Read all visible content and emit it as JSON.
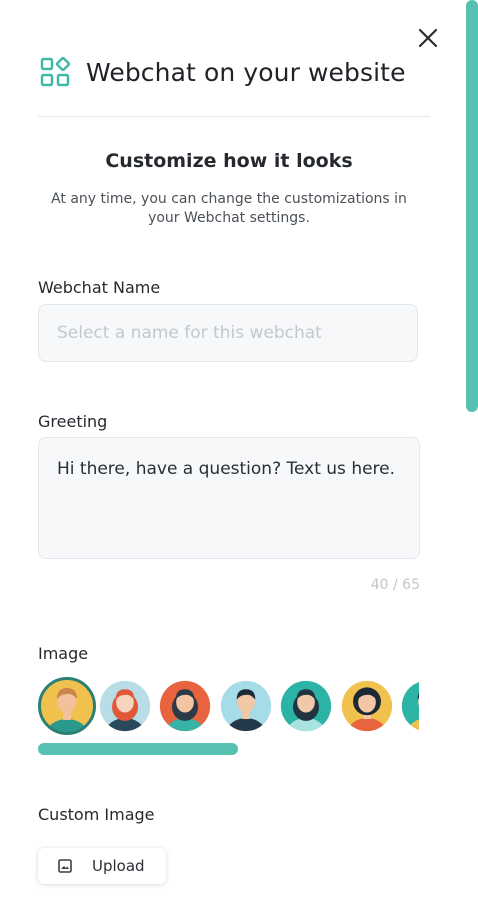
{
  "header": {
    "title": "Webchat on your website",
    "logo_icon": "widgets-icon",
    "close_icon": "close-icon"
  },
  "section": {
    "title": "Customize how it looks",
    "description": "At any time, you can change the customizations in your Webchat settings."
  },
  "webchat_name": {
    "label": "Webchat Name",
    "value": "",
    "placeholder": "Select a name for this webchat"
  },
  "greeting": {
    "label": "Greeting",
    "value": "Hi there, have a question? Text us here.",
    "counter": "40 / 65"
  },
  "image": {
    "label": "Image",
    "selected_index": 0,
    "avatars": [
      {
        "name": "avatar-man-short-hair",
        "bg": "#f1c14e",
        "skin": "#f2c09a",
        "hair": "#c9854a",
        "shirt": "#2a9a8c",
        "hair_style": "short"
      },
      {
        "name": "avatar-woman-red-hair",
        "bg": "#b9dde6",
        "skin": "#f5d3bd",
        "hair": "#e2573a",
        "shirt": "#29485b",
        "hair_style": "long"
      },
      {
        "name": "avatar-woman-dark-hair",
        "bg": "#e7643f",
        "skin": "#f3c4a2",
        "hair": "#2c3a48",
        "shirt": "#36b3a6",
        "hair_style": "long"
      },
      {
        "name": "avatar-man-dark-hair",
        "bg": "#a6dbe8",
        "skin": "#f1c7a6",
        "hair": "#1d2a35",
        "shirt": "#23384a",
        "hair_style": "short"
      },
      {
        "name": "avatar-woman-teal",
        "bg": "#2bb3a6",
        "skin": "#f1c9aa",
        "hair": "#1f3340",
        "shirt": "#a8e3de",
        "hair_style": "long"
      },
      {
        "name": "avatar-woman-curly",
        "bg": "#f1c14e",
        "skin": "#f3c7a6",
        "hair": "#1c2833",
        "shirt": "#e7643f",
        "hair_style": "curly"
      },
      {
        "name": "avatar-partial",
        "bg": "#2bb3a6",
        "skin": "#f1c9aa",
        "hair": "#1c2833",
        "shirt": "#f1c14e",
        "hair_style": "short"
      }
    ]
  },
  "custom_image": {
    "label": "Custom Image",
    "upload_label": "Upload",
    "upload_icon": "image-icon"
  },
  "colors": {
    "accent": "#56c1b0",
    "text": "#1f2328",
    "field_bg": "#f6f8fa",
    "field_border": "#e3e7ec"
  }
}
